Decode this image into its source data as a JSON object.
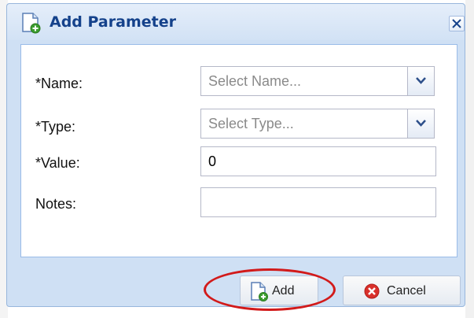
{
  "dialog": {
    "title": "Add Parameter",
    "title_icon": "document-add-icon",
    "close_icon": "close-icon"
  },
  "form": {
    "name": {
      "label": "*Name:",
      "placeholder": "Select Name..."
    },
    "type": {
      "label": "*Type:",
      "placeholder": "Select Type..."
    },
    "value": {
      "label": "*Value:",
      "value": "0"
    },
    "notes": {
      "label": "Notes:",
      "value": ""
    }
  },
  "buttons": {
    "add_label": "Add",
    "add_icon": "document-add-icon",
    "cancel_label": "Cancel",
    "cancel_icon": "cancel-icon"
  },
  "annotation": {
    "color": "#d21a1a"
  },
  "colors": {
    "title_text": "#15428b",
    "header_bg": "#d2e2f5",
    "border": "#99bbe8"
  }
}
